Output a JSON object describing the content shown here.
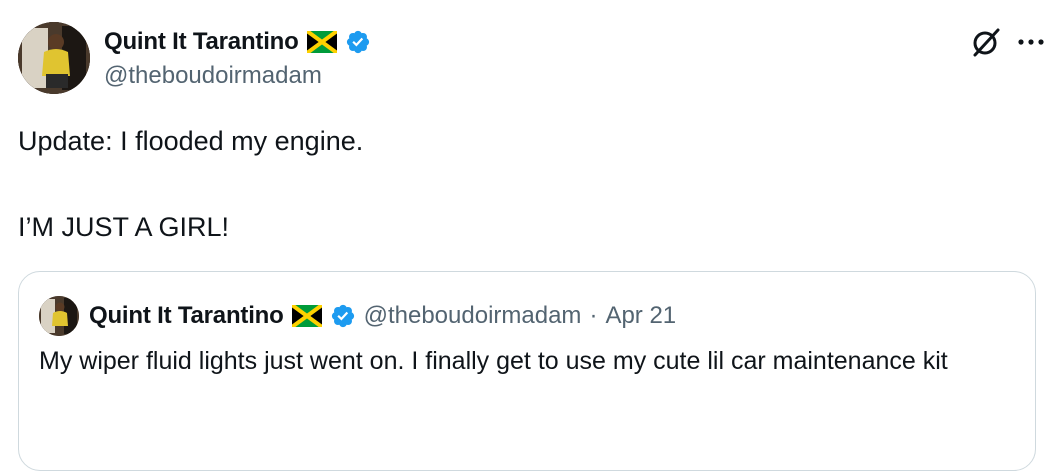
{
  "tweet": {
    "author": {
      "display_name": "Quint It Tarantino",
      "handle": "@theboudoirmadam",
      "flag_icon": "jamaica-flag-icon",
      "verified_icon": "verified-badge-icon"
    },
    "actions": {
      "grok_icon": "grok-icon",
      "more_icon": "more-options-icon"
    },
    "text_line1": "Update: I flooded my engine.",
    "text_line2": "I’M JUST A GIRL!",
    "quoted": {
      "display_name": "Quint It Tarantino",
      "handle": "@theboudoirmadam",
      "separator": "·",
      "date": "Apr 21",
      "text": "My wiper fluid lights just went on. I finally get to use my cute lil car maintenance kit"
    }
  },
  "colors": {
    "text_primary": "#0f1419",
    "text_secondary": "#536471",
    "verified_blue": "#1d9bf0",
    "border": "#cfd9de",
    "flag_green": "#009b3a",
    "flag_gold": "#fed100",
    "flag_black": "#000000"
  }
}
